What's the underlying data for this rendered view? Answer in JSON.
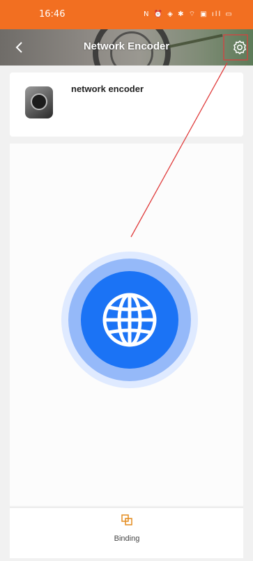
{
  "status_bar": {
    "time": "16:46",
    "icons": "N ⏰ ◈ ✱ ⌔ ▣ ıll ▭"
  },
  "header": {
    "title": "Network Encoder"
  },
  "device": {
    "name": "network encoder"
  },
  "bottom": {
    "binding_label": "Binding"
  },
  "colors": {
    "status_bar": "#f26f21",
    "accent_blue": "#1b73f5",
    "binding_icon": "#e38b1e",
    "annotation": "#e03c3c"
  }
}
